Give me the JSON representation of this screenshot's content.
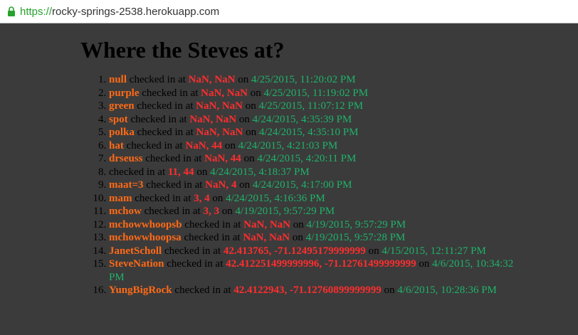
{
  "browser": {
    "url_scheme": "https://",
    "url_host": "rocky-springs-2538.herokuapp.com"
  },
  "page": {
    "title": "Where the Steves at?",
    "checked_in_text": " checked in at ",
    "on_text": " on "
  },
  "checkins": [
    {
      "user": "null",
      "location": "NaN, NaN",
      "time": "4/25/2015, 11:20:02 PM"
    },
    {
      "user": "purple",
      "location": "NaN, NaN",
      "time": "4/25/2015, 11:19:02 PM"
    },
    {
      "user": "green",
      "location": "NaN, NaN",
      "time": "4/25/2015, 11:07:12 PM"
    },
    {
      "user": "spot",
      "location": "NaN, NaN",
      "time": "4/24/2015, 4:35:39 PM"
    },
    {
      "user": "polka",
      "location": "NaN, NaN",
      "time": "4/24/2015, 4:35:10 PM"
    },
    {
      "user": "hat",
      "location": "NaN, 44",
      "time": "4/24/2015, 4:21:03 PM"
    },
    {
      "user": "drseuss",
      "location": "NaN, 44",
      "time": "4/24/2015, 4:20:11 PM"
    },
    {
      "user": "",
      "location": "11, 44",
      "time": "4/24/2015, 4:18:37 PM"
    },
    {
      "user": "maat=3",
      "location": "NaN, 4",
      "time": "4/24/2015, 4:17:00 PM"
    },
    {
      "user": "mam",
      "location": "3, 4",
      "time": "4/24/2015, 4:16:36 PM"
    },
    {
      "user": "mchow",
      "location": "3, 3",
      "time": "4/19/2015, 9:57:29 PM"
    },
    {
      "user": "mchowwhoopsb",
      "location": "NaN, NaN",
      "time": "4/19/2015, 9:57:29 PM"
    },
    {
      "user": "mchowwhoopsa",
      "location": "NaN, NaN",
      "time": "4/19/2015, 9:57:28 PM"
    },
    {
      "user": "JanetScholl",
      "location": "42.413765, -71.12495179999999",
      "time": "4/15/2015, 12:11:27 PM"
    },
    {
      "user": "SteveNation",
      "location": "42.412251499999996, -71.12761499999999",
      "time": "4/6/2015, 10:34:32 PM"
    },
    {
      "user": "YungBigRock",
      "location": "42.4122943, -71.12760899999999",
      "time": "4/6/2015, 10:28:36 PM"
    }
  ],
  "colors": {
    "background": "#3b3b3b",
    "user": "#ff6a17",
    "location": "#ff2e2e",
    "time": "#1fb36a"
  },
  "icons": {
    "lock": "lock-icon"
  }
}
